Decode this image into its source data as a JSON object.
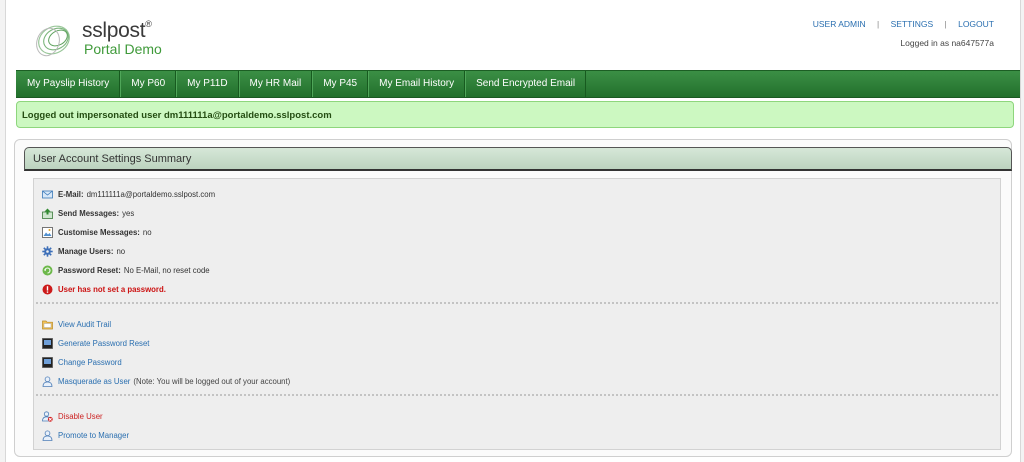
{
  "header": {
    "brand": "sslpost",
    "brand_mark": "®",
    "subtitle": "Portal Demo",
    "links": [
      "USER ADMIN",
      "SETTINGS",
      "LOGOUT"
    ],
    "separator": "|",
    "login_status": "Logged in as na647577a"
  },
  "nav": {
    "items": [
      "My Payslip History",
      "My P60",
      "My P11D",
      "My HR Mail",
      "My P45",
      "My Email History",
      "Send Encrypted Email"
    ]
  },
  "alert": {
    "message": "Logged out impersonated user dm111111a@portaldemo.sslpost.com"
  },
  "panel": {
    "title": "User Account Settings Summary",
    "details": {
      "email_label": "E-Mail:",
      "email_value": "dm111111a@portaldemo.sslpost.com",
      "send_label": "Send Messages:",
      "send_value": "yes",
      "customise_label": "Customise Messages:",
      "customise_value": "no",
      "manage_label": "Manage Users:",
      "manage_value": "no",
      "reset_label": "Password Reset:",
      "reset_value": "No E-Mail, no reset code",
      "warning": "User has not set a password."
    },
    "actions": {
      "audit": "View Audit Trail",
      "generate_reset": "Generate Password Reset",
      "change_password": "Change Password",
      "masquerade": "Masquerade as User",
      "masquerade_note": "(Note: You will be logged out of your account)",
      "disable": "Disable User",
      "promote": "Promote to Manager"
    }
  },
  "colors": {
    "nav_green": "#2a7d34",
    "alert_bg": "#ccf8c1",
    "link_blue": "#2a6fb0",
    "warning_red": "#cc1111"
  }
}
